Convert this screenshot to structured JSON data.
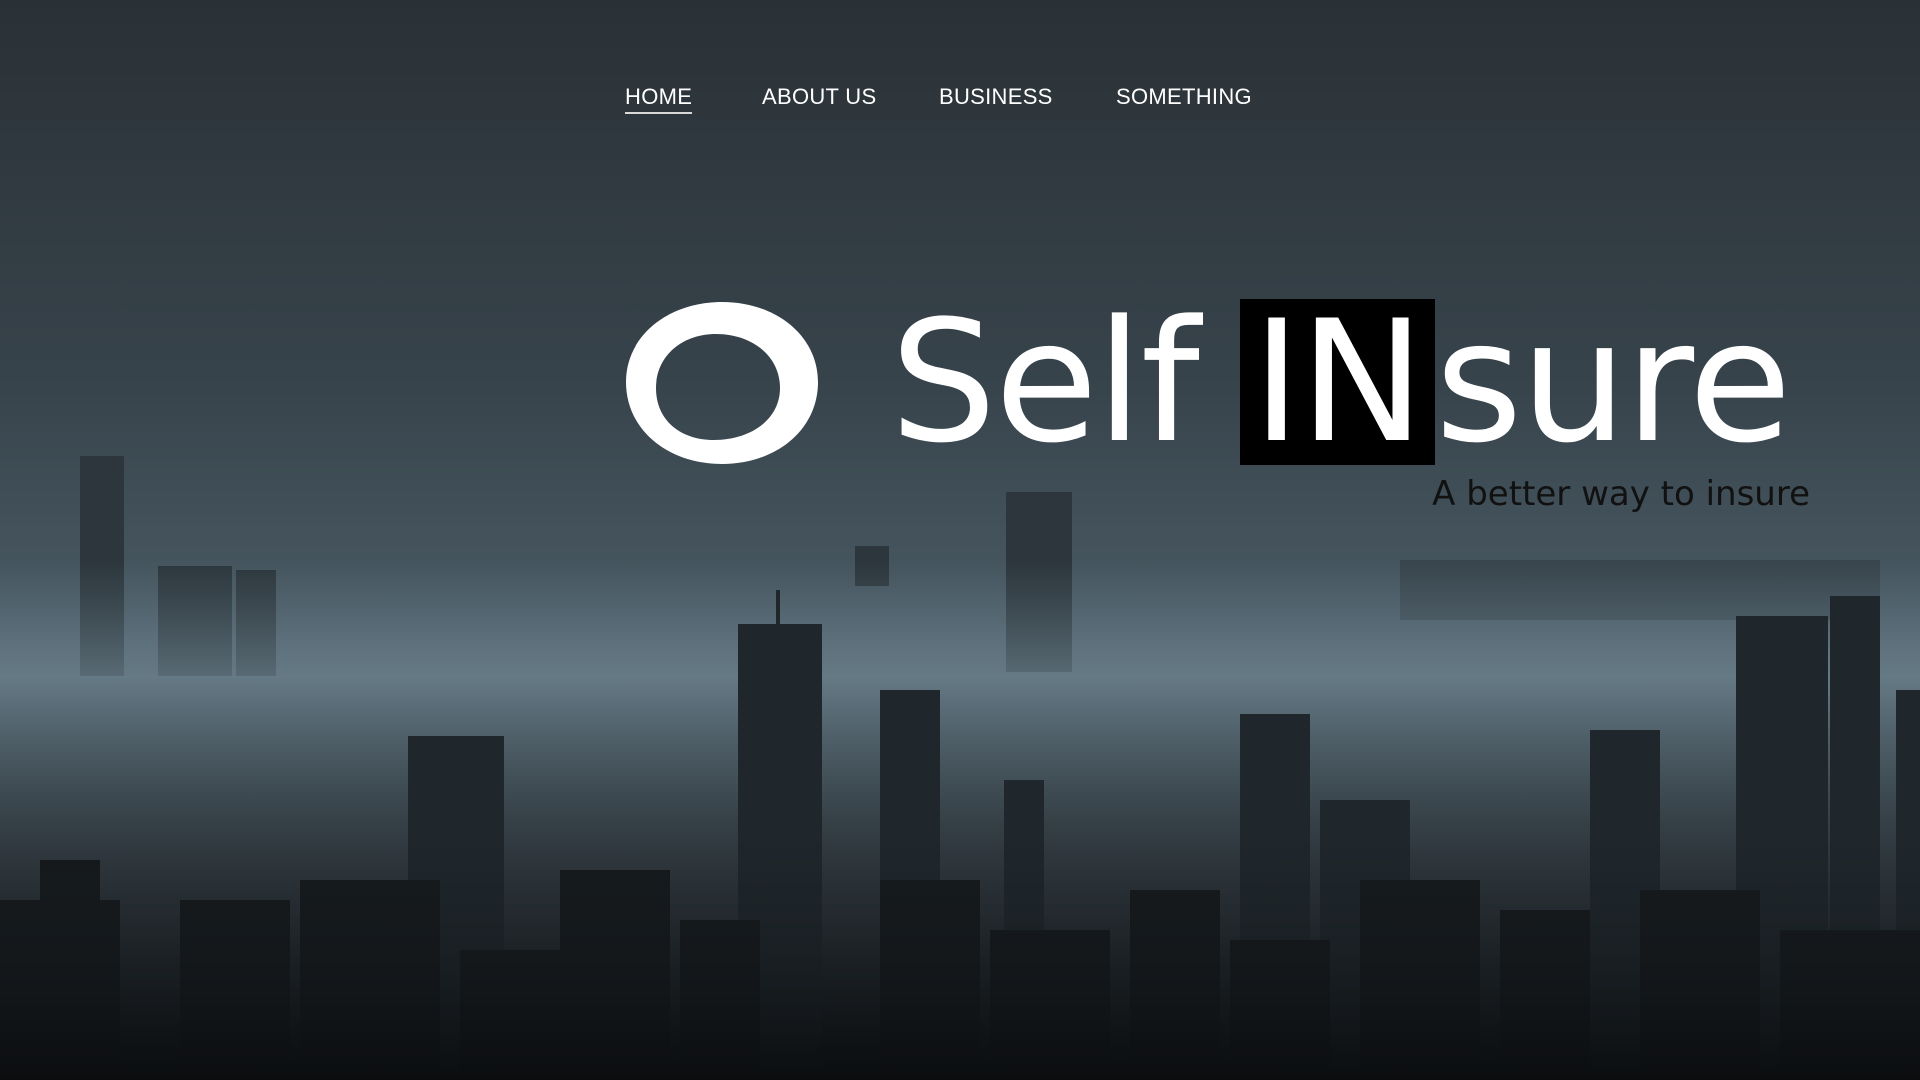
{
  "nav": {
    "items": [
      {
        "label": "HOME",
        "active": true
      },
      {
        "label": "ABOUT US",
        "active": false
      },
      {
        "label": "BUSINESS",
        "active": false
      },
      {
        "label": "SOMETHING",
        "active": false
      }
    ]
  },
  "brand": {
    "logo_icon": "ring-logo-icon",
    "name_part1": "Self",
    "name_part2": "IN",
    "name_part3": "sure",
    "tagline": "A better way to insure"
  },
  "background": {
    "description_icon": "foggy-city-skyline-photo"
  },
  "colors": {
    "text_primary": "#ffffff",
    "highlight_bg": "#000000",
    "tagline": "#111111",
    "sky": "#37434b"
  }
}
